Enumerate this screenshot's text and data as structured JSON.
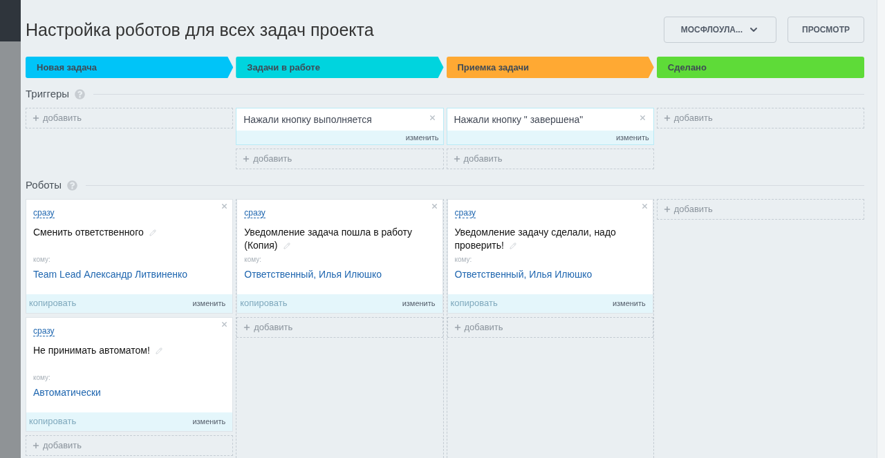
{
  "header": {
    "title": "Настройка роботов для всех задач проекта",
    "project_select": "МОСФЛОУЛА...",
    "preview_button": "ПРОСМОТР"
  },
  "stages": [
    {
      "name": "Новая задача",
      "color": "#00c4f8"
    },
    {
      "name": "Задачи в работе",
      "color": "#00d4de"
    },
    {
      "name": "Приемка задачи",
      "color": "#ffa933"
    },
    {
      "name": "Сделано",
      "color": "#5edb38"
    }
  ],
  "triggers": {
    "title": "Триггеры",
    "columns": [
      {
        "add": "добавить"
      },
      {
        "items": [
          {
            "name": "Нажали кнопку выполняется",
            "edit": "изменить"
          }
        ],
        "add": "добавить"
      },
      {
        "items": [
          {
            "name": "Нажали кнопку \" завершена\"",
            "edit": "изменить"
          }
        ],
        "add": "добавить"
      },
      {
        "add": "добавить"
      }
    ]
  },
  "robots": {
    "title": "Роботы",
    "columns": [
      {
        "items": [
          {
            "delay": "сразу",
            "name": "Сменить ответственного",
            "to_label": "кому:",
            "to": "Team Lead Александр Литвиненко",
            "copy": "копировать",
            "edit": "изменить"
          },
          {
            "delay": "сразу",
            "name": "Не принимать автоматом!",
            "to_label": "кому:",
            "to": "Автоматически",
            "copy": "копировать",
            "edit": "изменить"
          }
        ],
        "add": "добавить"
      },
      {
        "items": [
          {
            "delay": "сразу",
            "name": "Уведомление задача пошла в работу (Копия)",
            "to_label": "кому:",
            "to": "Ответственный, Илья Илюшко",
            "copy": "копировать",
            "edit": "изменить"
          }
        ],
        "add": "добавить"
      },
      {
        "items": [
          {
            "delay": "сразу",
            "name": "Уведомление задачу сделали, надо проверить!",
            "to_label": "кому:",
            "to": "Ответственный, Илья Илюшко",
            "copy": "копировать",
            "edit": "изменить"
          }
        ],
        "add": "добавить"
      },
      {
        "add": "добавить"
      }
    ]
  }
}
